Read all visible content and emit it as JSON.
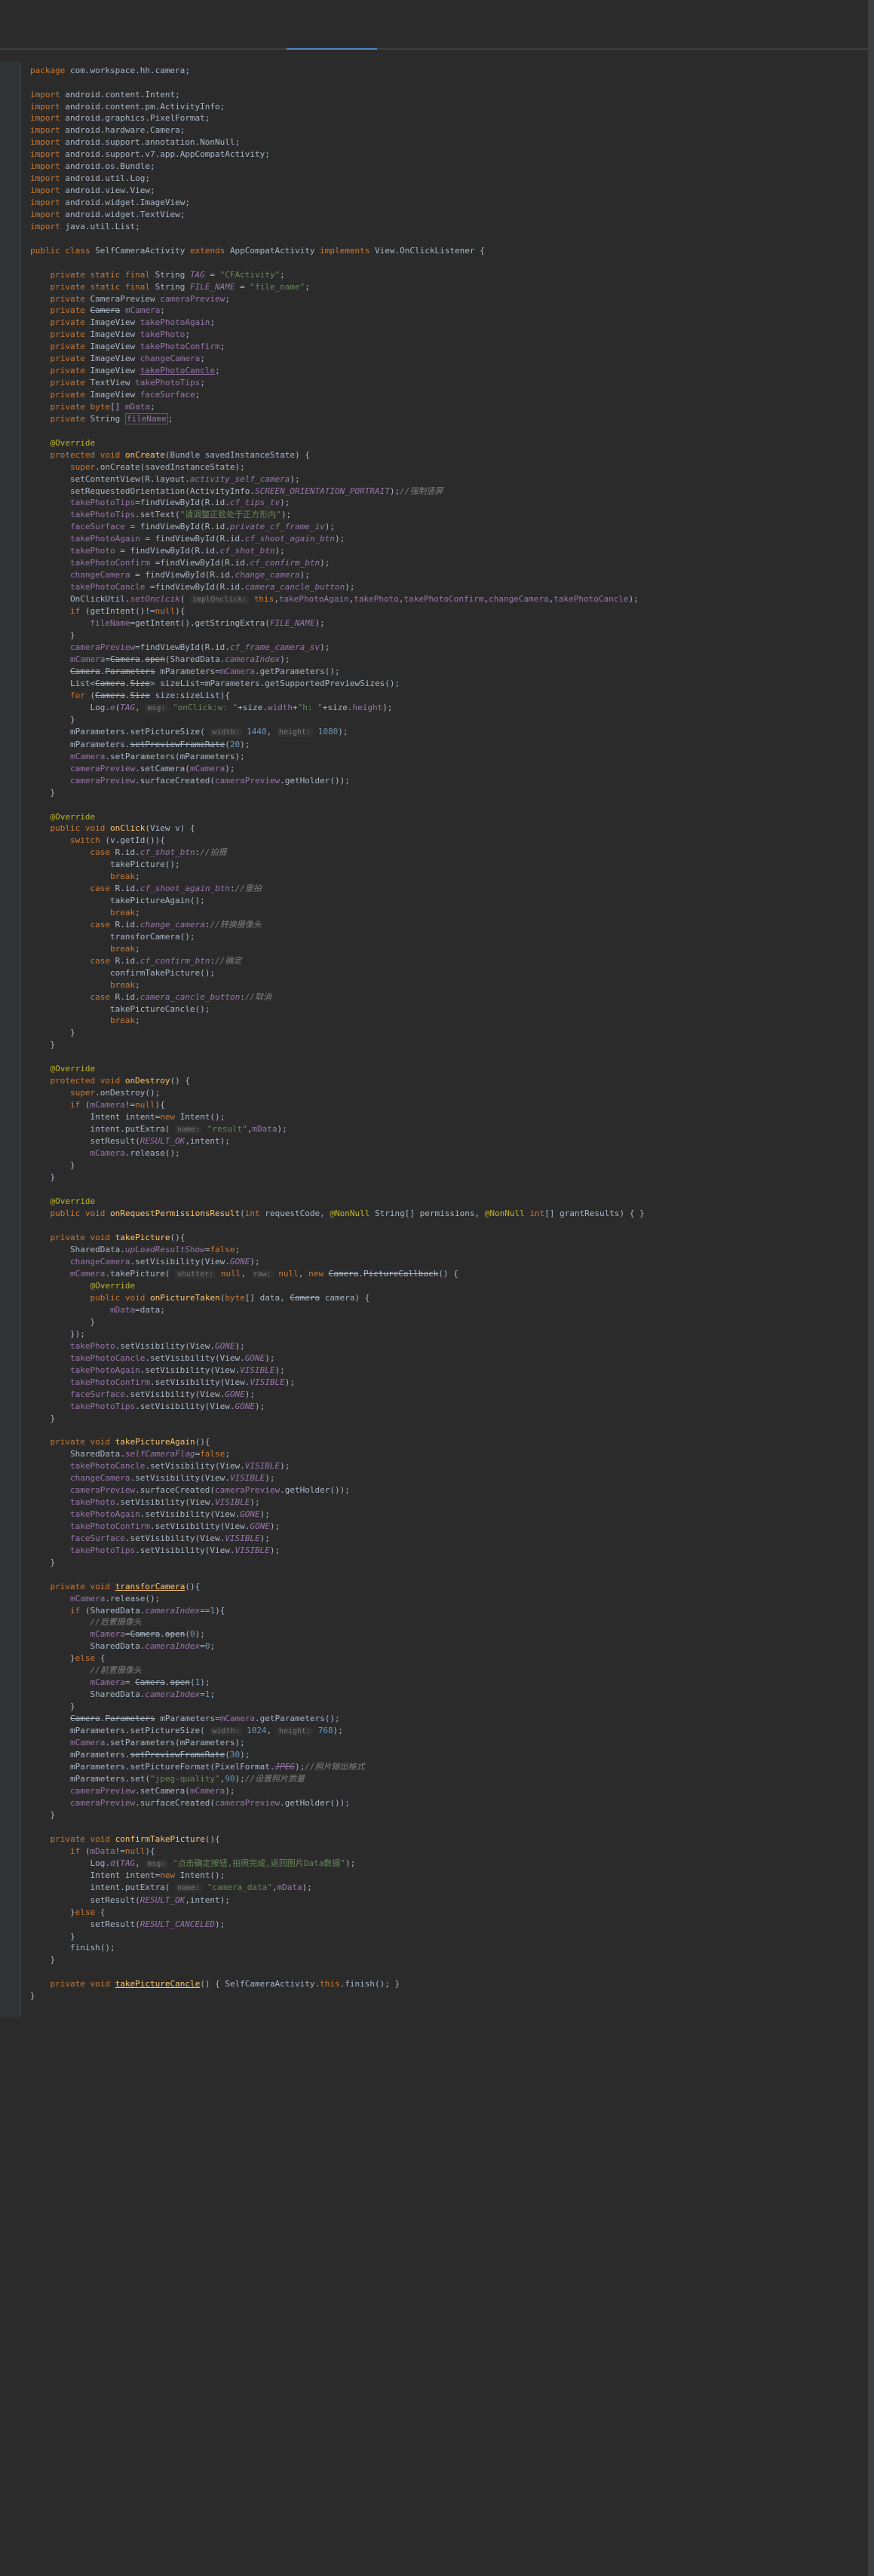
{
  "package_line": "package com.workspace.hh.camera;",
  "imports": [
    "import android.content.Intent;",
    "import android.content.pm.ActivityInfo;",
    "import android.graphics.PixelFormat;",
    "import android.hardware.Camera;",
    "import android.support.annotation.NonNull;",
    "import android.support.v7.app.AppCompatActivity;",
    "import android.os.Bundle;",
    "import android.util.Log;",
    "import android.view.View;",
    "import android.widget.ImageView;",
    "import android.widget.TextView;",
    "import java.util.List;"
  ],
  "class_decl": {
    "modifiers": "public class",
    "name": "SelfCameraActivity",
    "extends": "AppCompatActivity",
    "implements": "View.OnClickListener"
  },
  "fields": [
    {
      "decl": "private static final String",
      "name": "TAG",
      "val": "\"CFActivity\""
    },
    {
      "decl": "private static final String",
      "name": "FILE_NAME",
      "val": "\"file_name\""
    },
    {
      "decl": "private CameraPreview",
      "name": "cameraPreview"
    },
    {
      "decl": "private Camera",
      "name": "mCamera",
      "strike": true
    },
    {
      "decl": "private ImageView",
      "name": "takePhotoAgain"
    },
    {
      "decl": "private ImageView",
      "name": "takePhoto"
    },
    {
      "decl": "private ImageView",
      "name": "takePhotoConfirm"
    },
    {
      "decl": "private ImageView",
      "name": "changeCamera"
    },
    {
      "decl": "private ImageView",
      "name": "takePhotoCancle",
      "underline": true
    },
    {
      "decl": "private TextView",
      "name": "takePhotoTips"
    },
    {
      "decl": "private ImageView",
      "name": "faceSurface"
    },
    {
      "decl": "private byte[]",
      "name": "mData"
    },
    {
      "decl": "private String",
      "name": "fileName",
      "boxed": true
    }
  ],
  "onCreate": {
    "ann": "@Override",
    "sig": "protected void onCreate(Bundle savedInstanceState) {",
    "body": [
      "super.onCreate(savedInstanceState);",
      "setContentView(R.layout.activity_self_camera);",
      "setRequestedOrientation(ActivityInfo.SCREEN_ORIENTATION_PORTRAIT);//强制竖屏",
      "takePhotoTips=findViewById(R.id.cf_tips_tv);",
      "takePhotoTips.setText(\"请调整正脸处于正方形内\");",
      "faceSurface = findViewById(R.id.private_cf_frame_iv);",
      "takePhotoAgain = findViewById(R.id.cf_shoot_again_btn);",
      "takePhoto = findViewById(R.id.cf_shot_btn);",
      "takePhotoConfirm =findViewById(R.id.cf_confirm_btn);",
      "changeCamera = findViewById(R.id.change_camera);",
      "takePhotoCancle =findViewById(R.id.camera_cancle_button);",
      "OnClickUtil.setOnclcik( implOnclick: this,takePhotoAgain,takePhoto,takePhotoConfirm,changeCamera,takePhotoCancle);",
      "if (getIntent()!=null){",
      "    fileName=getIntent().getStringExtra(FILE_NAME);",
      "}",
      "cameraPreview=findViewById(R.id.cf_frame_camera_sv);",
      "mCamera=Camera.open(SharedData.cameraIndex);",
      "Camera.Parameters mParameters=mCamera.getParameters();",
      "List<Camera.Size> sizeList=mParameters.getSupportedPreviewSizes();",
      "for (Camera.Size size:sizeList){",
      "    Log.e(TAG, msg: \"onClick:w: \"+size.width+\"h: \"+size.height);",
      "}",
      "mParameters.setPictureSize( width: 1440, height: 1080);",
      "mParameters.setPreviewFrameRate(20);",
      "mCamera.setParameters(mParameters);",
      "cameraPreview.setCamera(mCamera);",
      "cameraPreview.surfaceCreated(cameraPreview.getHolder());"
    ]
  },
  "onClick": {
    "ann": "@Override",
    "sig": "public void onClick(View v) {",
    "switch": "switch (v.getId()){",
    "cases": [
      {
        "label": "case R.id.cf_shot_btn://拍摄",
        "call": "takePicture();"
      },
      {
        "label": "case R.id.cf_shoot_again_btn://重拍",
        "call": "takePictureAgain();"
      },
      {
        "label": "case R.id.change_camera://转换摄像头",
        "call": "transforCamera();"
      },
      {
        "label": "case R.id.cf_confirm_btn://确定",
        "call": "confirmTakePicture();"
      },
      {
        "label": "case R.id.camera_cancle_button://取消",
        "call": "takePictureCancle();"
      }
    ]
  },
  "onDestroy": {
    "ann": "@Override",
    "sig": "protected void onDestroy() {",
    "body": [
      "super.onDestroy();",
      "if (mCamera!=null){",
      "    Intent intent=new Intent();",
      "    intent.putExtra( name: \"result\",mData);",
      "    setResult(RESULT_OK,intent);",
      "    mCamera.release();",
      "}"
    ]
  },
  "onRequest": {
    "ann": "@Override",
    "sig": "public void onRequestPermissionsResult(int requestCode, @NonNull String[] permissions, @NonNull int[] grantResults) { }"
  },
  "takePicture": {
    "sig": "private void takePicture(){",
    "body": [
      "SharedData.upLoadResultShow=false;",
      "changeCamera.setVisibility(View.GONE);",
      "mCamera.takePicture( shutter: null, raw: null, new Camera.PictureCallback() {",
      "    @Override",
      "    public void onPictureTaken(byte[] data, Camera camera) {",
      "        mData=data;",
      "    }",
      "});",
      "takePhoto.setVisibility(View.GONE);",
      "takePhotoCancle.setVisibility(View.GONE);",
      "takePhotoAgain.setVisibility(View.VISIBLE);",
      "takePhotoConfirm.setVisibility(View.VISIBLE);",
      "faceSurface.setVisibility(View.GONE);",
      "takePhotoTips.setVisibility(View.GONE);"
    ]
  },
  "takePictureAgain": {
    "sig": "private void takePictureAgain(){",
    "body": [
      "SharedData.selfCameraFlag=false;",
      "takePhotoCancle.setVisibility(View.VISIBLE);",
      "changeCamera.setVisibility(View.VISIBLE);",
      "cameraPreview.surfaceCreated(cameraPreview.getHolder());",
      "takePhoto.setVisibility(View.VISIBLE);",
      "takePhotoAgain.setVisibility(View.GONE);",
      "takePhotoConfirm.setVisibility(View.GONE);",
      "faceSurface.setVisibility(View.VISIBLE);",
      "takePhotoTips.setVisibility(View.VISIBLE);"
    ]
  },
  "transforCamera": {
    "sig": "private void transforCamera(){",
    "body": [
      "mCamera.release();",
      "if (SharedData.cameraIndex==1){",
      "    //后置摄像头",
      "    mCamera=Camera.open(0);",
      "    SharedData.cameraIndex=0;",
      "}else {",
      "    //前置摄像头",
      "    mCamera= Camera.open(1);",
      "    SharedData.cameraIndex=1;",
      "}",
      "Camera.Parameters mParameters=mCamera.getParameters();",
      "mParameters.setPictureSize( width: 1024, height: 768);",
      "mCamera.setParameters(mParameters);",
      "mParameters.setPreviewFrameRate(30);",
      "mParameters.setPictureFormat(PixelFormat.JPEG);//照片输出格式",
      "mParameters.set(\"jpeg-quality\",90);//设置照片质量",
      "cameraPreview.setCamera(mCamera);",
      "cameraPreview.surfaceCreated(cameraPreview.getHolder());"
    ]
  },
  "confirmTakePicture": {
    "sig": "private void confirmTakePicture(){",
    "body": [
      "if (mData!=null){",
      "    Log.d(TAG, msg: \"点击确定按钮,拍照完成,返回图片Data数据\");",
      "    Intent intent=new Intent();",
      "    intent.putExtra( name: \"camera_data\",mData);",
      "    setResult(RESULT_OK,intent);",
      "}else {",
      "    setResult(RESULT_CANCELED);",
      "}",
      "finish();"
    ]
  },
  "takePictureCancle": {
    "sig": "private void takePictureCancle() { SelfCameraActivity.this.finish(); }"
  }
}
